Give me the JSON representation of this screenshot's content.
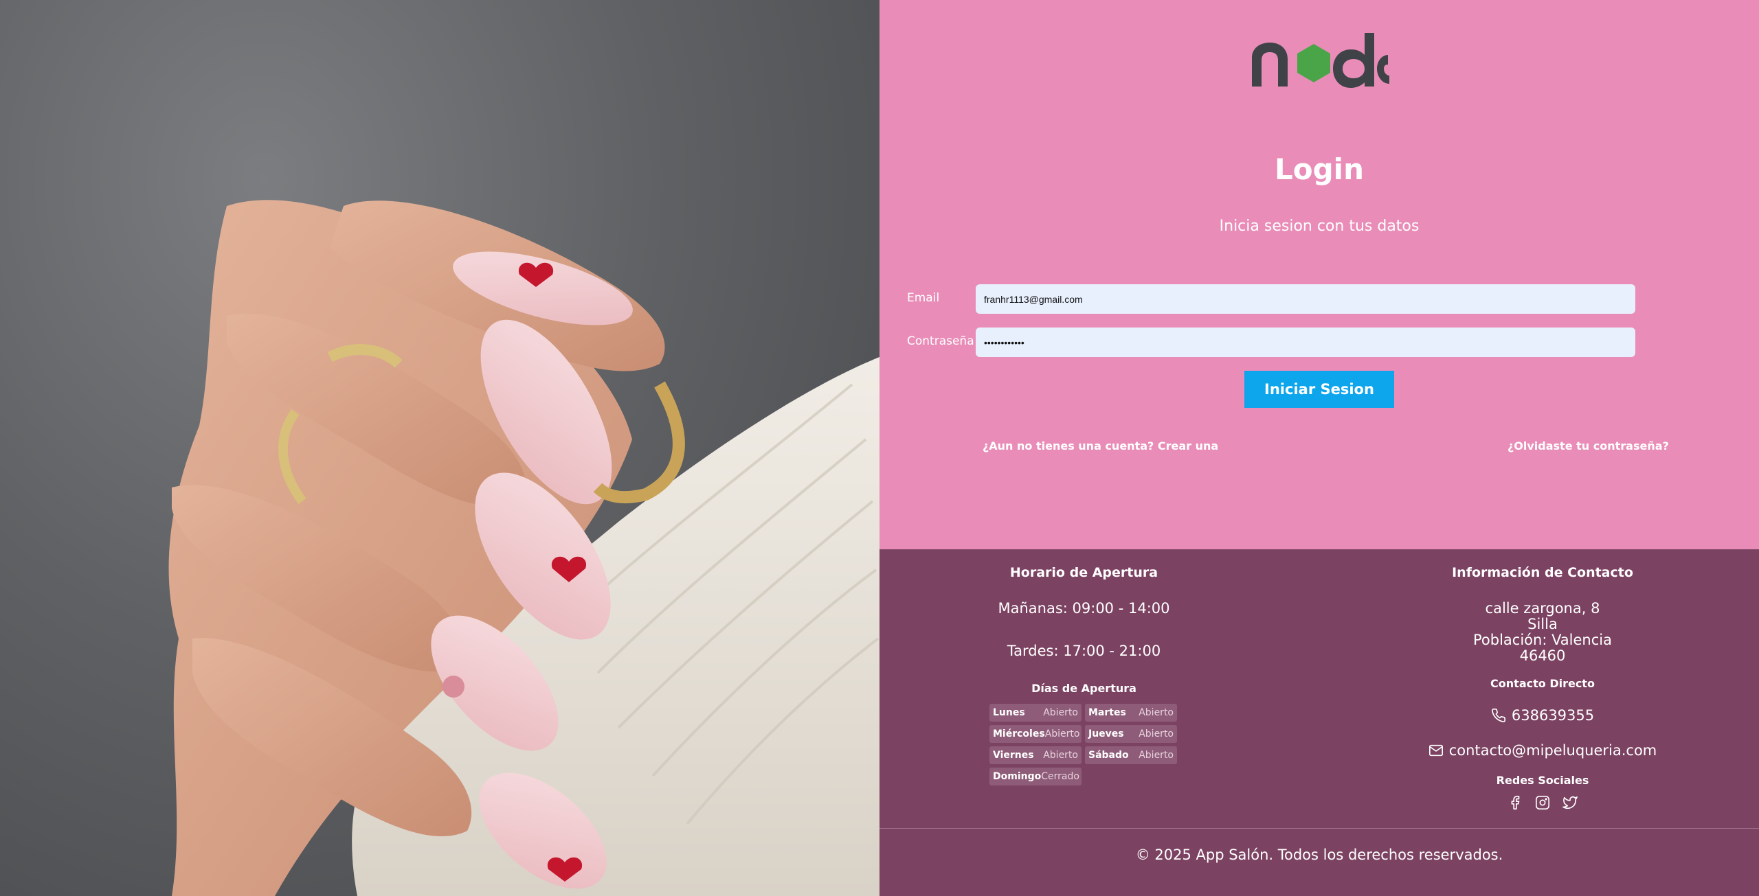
{
  "login": {
    "title": "Login",
    "subtitle": "Inicia sesion con tus datos",
    "email_label": "Email",
    "email_value": "franhr1113@gmail.com",
    "password_label": "Contraseña",
    "password_value": "••••••••••••",
    "submit_label": "Iniciar Sesion",
    "register_link": "¿Aun no tienes una cuenta? Crear una",
    "forgot_link": "¿Olvidaste tu contraseña?"
  },
  "footer": {
    "hours": {
      "title": "Horario de Apertura",
      "morning": "Mañanas: 09:00 - 14:00",
      "afternoon": "Tardes: 17:00 - 21:00",
      "days_title": "Días de Apertura",
      "days": [
        {
          "name": "Lunes",
          "status": "Abierto"
        },
        {
          "name": "Martes",
          "status": "Abierto"
        },
        {
          "name": "Miércoles",
          "status": "Abierto"
        },
        {
          "name": "Jueves",
          "status": "Abierto"
        },
        {
          "name": "Viernes",
          "status": "Abierto"
        },
        {
          "name": "Sábado",
          "status": "Abierto"
        },
        {
          "name": "Domingo",
          "status": "Cerrado"
        }
      ]
    },
    "contact": {
      "title": "Información de Contacto",
      "address": [
        "calle zargona, 8",
        "Silla",
        "Población: Valencia",
        "46460"
      ],
      "direct_title": "Contacto Directo",
      "phone": "638639355",
      "email": "contacto@mipeluqueria.com",
      "social_title": "Redes Sociales",
      "social_icons": [
        "facebook-icon",
        "instagram-icon",
        "twitter-icon"
      ]
    },
    "copyright": "© 2025 App Salón. Todos los derechos reservados."
  },
  "colors": {
    "panel_pink": "#e98db8",
    "footer_plum": "#7c4262",
    "button_blue": "#0da5ec",
    "input_bg": "#e8f0fe",
    "logo_green": "#4aa548",
    "logo_dark": "#3f4348"
  }
}
